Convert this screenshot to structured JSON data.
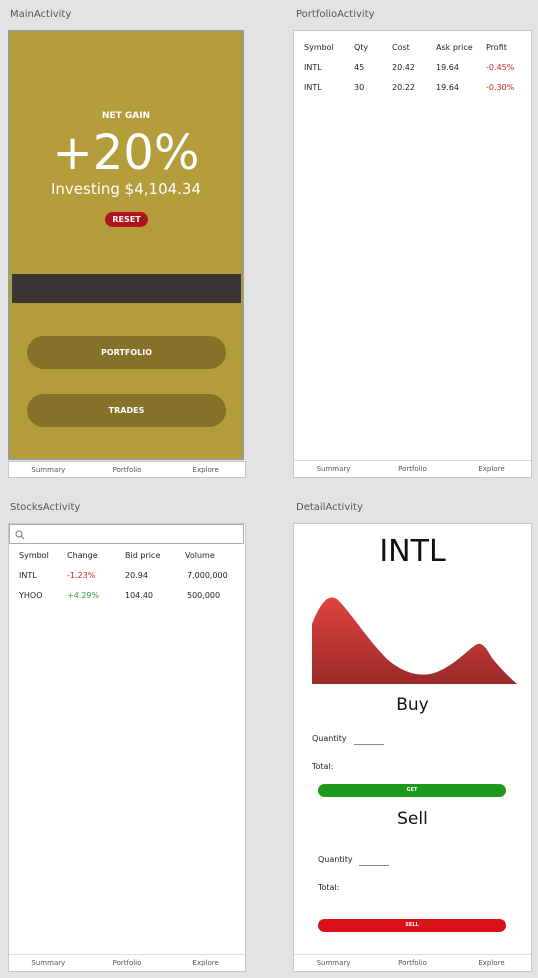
{
  "screens": {
    "main": {
      "title": "MainActivity",
      "net_gain_label": "NET GAIN",
      "gain_pct": "+20%",
      "investing": "Investing $4,104.34",
      "reset_label": "RESET",
      "portfolio_label": "PORTFOLIO",
      "trades_label": "TRADES"
    },
    "portfolio": {
      "title": "PortfolioActivity",
      "headers": [
        "Symbol",
        "Qty",
        "Cost",
        "Ask price",
        "Profit"
      ],
      "rows": [
        [
          "INTL",
          "45",
          "20.42",
          "19.64",
          "-0.45%"
        ],
        [
          "INTL",
          "30",
          "20.22",
          "19.64",
          "-0.30%"
        ]
      ]
    },
    "stocks": {
      "title": "StocksActivity",
      "headers": [
        "Symbol",
        "Change",
        "Bid price",
        "Volume"
      ],
      "rows": [
        [
          "INTL",
          "-1.23%",
          "20.94",
          "7,000,000"
        ],
        [
          "YHOO",
          "+4.29%",
          "104.40",
          "500,000"
        ]
      ]
    },
    "detail": {
      "title": "DetailActivity",
      "symbol": "INTL",
      "buy_heading": "Buy",
      "sell_heading": "Sell",
      "quantity_label": "Quantity",
      "total_label": "Total:",
      "get_label": "GET",
      "sell_label": "SELL"
    }
  },
  "nav": [
    "Summary",
    "Portfolio",
    "Explore"
  ],
  "colors": {
    "gold": "#b49c3a",
    "negative": "#d0241e",
    "positive": "#2aa52a",
    "get": "#1c9a1c",
    "sell": "#d8111a"
  },
  "icons": {
    "search": "search-icon"
  }
}
